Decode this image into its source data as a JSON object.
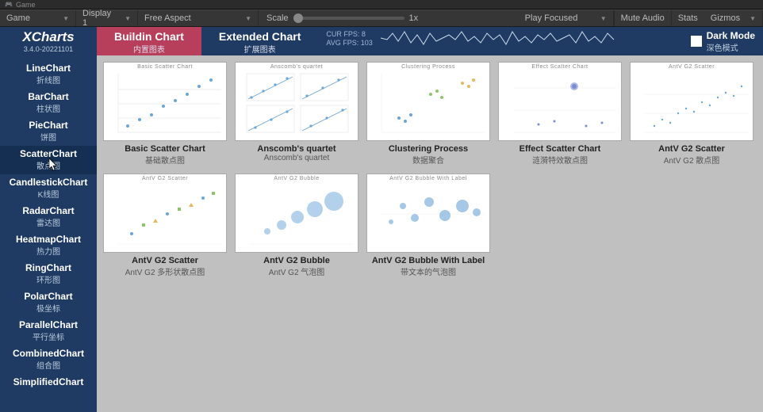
{
  "window": {
    "title": "Game"
  },
  "toolbar": {
    "game": "Game",
    "display": "Display 1",
    "aspect": "Free Aspect",
    "scale_label": "Scale",
    "scale_value": "1x",
    "play_focused": "Play Focused",
    "mute_audio": "Mute Audio",
    "stats": "Stats",
    "gizmos": "Gizmos"
  },
  "brand": {
    "name": "XCharts",
    "version": "3.4.0-20221101"
  },
  "tabs": [
    {
      "en": "Buildin Chart",
      "cn": "内置图表",
      "active": true
    },
    {
      "en": "Extended Chart",
      "cn": "扩展图表",
      "active": false
    }
  ],
  "fps": {
    "cur_label": "CUR FPS:",
    "cur": "8",
    "avg_label": "AVG FPS:",
    "avg": "103"
  },
  "darkmode": {
    "en": "Dark Mode",
    "cn": "深色模式"
  },
  "sidebar": [
    {
      "en": "LineChart",
      "cn": "折线图"
    },
    {
      "en": "BarChart",
      "cn": "柱状图"
    },
    {
      "en": "PieChart",
      "cn": "饼图"
    },
    {
      "en": "ScatterChart",
      "cn": "散点图",
      "active": true
    },
    {
      "en": "CandlestickChart",
      "cn": "K线图"
    },
    {
      "en": "RadarChart",
      "cn": "雷达图"
    },
    {
      "en": "HeatmapChart",
      "cn": "热力图"
    },
    {
      "en": "RingChart",
      "cn": "环形图"
    },
    {
      "en": "PolarChart",
      "cn": "极坐标"
    },
    {
      "en": "ParallelChart",
      "cn": "平行坐标"
    },
    {
      "en": "CombinedChart",
      "cn": "组合图"
    },
    {
      "en": "SimplifiedChart",
      "cn": ""
    }
  ],
  "cards": [
    {
      "title": "Basic Scatter Chart",
      "sub": "基础散点图"
    },
    {
      "title": "Anscomb's quartet",
      "sub": "Anscomb's quartet"
    },
    {
      "title": "Clustering Process",
      "sub": "数据聚合"
    },
    {
      "title": "Effect Scatter Chart",
      "sub": "涟漪特效散点图"
    },
    {
      "title": "AntV G2 Scatter",
      "sub": "AntV G2 散点图"
    },
    {
      "title": "AntV G2 Scatter",
      "sub": "AntV G2 多形状散点图"
    },
    {
      "title": "AntV G2 Bubble",
      "sub": "AntV G2 气泡图"
    },
    {
      "title": "AntV G2 Bubble With Label",
      "sub": "带文本的气泡图"
    }
  ]
}
